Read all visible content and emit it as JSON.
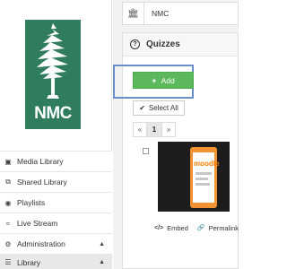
{
  "sidebar": {
    "logo_text": "NMC",
    "items": [
      {
        "label": "Media Library",
        "icon": "media-icon"
      },
      {
        "label": "Shared Library",
        "icon": "shared-icon"
      },
      {
        "label": "Playlists",
        "icon": "globe-icon"
      },
      {
        "label": "Live Stream",
        "icon": "wifi-icon"
      },
      {
        "label": "Administration",
        "icon": "gears-icon"
      },
      {
        "label": "Library",
        "icon": "library-icon"
      }
    ]
  },
  "search": {
    "value": "NMC",
    "icon": "institution-icon"
  },
  "panel": {
    "title": "Quizzes",
    "add_label": "Add",
    "select_all_label": "Select All",
    "pager": {
      "prev": "«",
      "current": "1",
      "next": "»"
    },
    "thumbnail_brand": "moodle",
    "actions": {
      "embed": "Embed",
      "permalink": "Permalink"
    }
  },
  "colors": {
    "logo": "#2f7d5d",
    "add_button": "#5cb85c",
    "highlight": "#6d8fc7"
  }
}
